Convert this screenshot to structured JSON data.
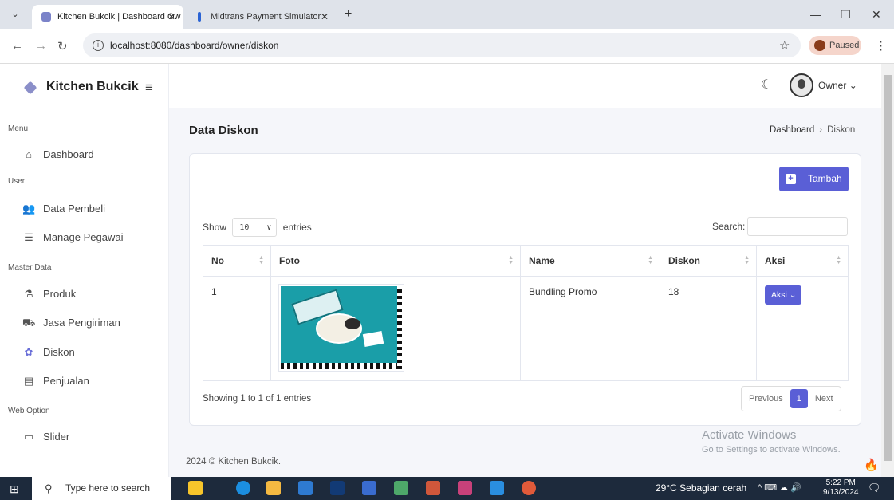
{
  "browser": {
    "tabs": [
      {
        "title": "Kitchen Bukcik | Dashboard Ow",
        "close": "✕"
      },
      {
        "title": "Midtrans Payment Simulator",
        "close": "✕"
      }
    ],
    "new_tab": "+",
    "url": "localhost:8080/dashboard/owner/diskon",
    "profile_status": "Paused"
  },
  "sidebar": {
    "brand": "Kitchen Bukcik",
    "sections": {
      "menu": "Menu",
      "user": "User",
      "master": "Master Data",
      "web": "Web Option"
    },
    "items": [
      {
        "label": "Dashboard",
        "icon": "home-icon"
      },
      {
        "label": "Data Pembeli",
        "icon": "users-icon"
      },
      {
        "label": "Manage Pegawai",
        "icon": "user-list-icon"
      },
      {
        "label": "Produk",
        "icon": "product-icon"
      },
      {
        "label": "Jasa Pengiriman",
        "icon": "truck-icon"
      },
      {
        "label": "Diskon",
        "icon": "discount-icon"
      },
      {
        "label": "Penjualan",
        "icon": "receipt-icon"
      },
      {
        "label": "Slider",
        "icon": "slider-icon"
      }
    ]
  },
  "header": {
    "user": "Owner"
  },
  "main": {
    "title": "Data Diskon",
    "breadcrumb": {
      "root": "Dashboard",
      "current": "Diskon"
    },
    "add_button": "Tambah",
    "show_label": "Show",
    "entries_value": "10",
    "entries_label": "entries",
    "search_label": "Search:",
    "columns": [
      "No",
      "Foto",
      "Name",
      "Diskon",
      "Aksi"
    ],
    "rows": [
      {
        "no": "1",
        "name": "Bundling Promo",
        "diskon": "18",
        "action": "Aksi"
      }
    ],
    "info": "Showing 1 to 1 of 1 entries",
    "pagination": {
      "previous": "Previous",
      "page": "1",
      "next": "Next"
    }
  },
  "footer": "2024 © Kitchen Bukcik.",
  "watermark": {
    "title": "Activate Windows",
    "subtitle": "Go to Settings to activate Windows."
  },
  "taskbar": {
    "search_placeholder": "Type here to search",
    "weather": "29°C  Sebagian cerah",
    "time": "5:22 PM",
    "date": "9/13/2024"
  },
  "colors": {
    "accent": "#5a5fd6",
    "sidebar_bg": "#ffffff",
    "page_bg": "#f5f6fa"
  }
}
